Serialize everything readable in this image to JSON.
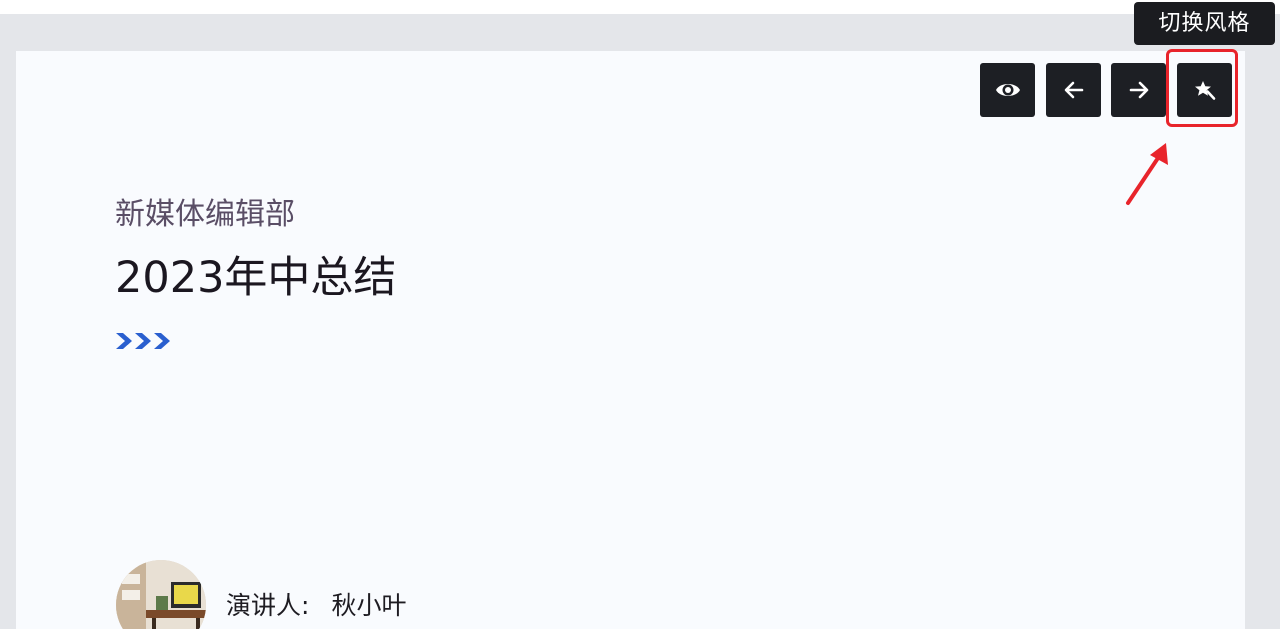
{
  "tooltip": {
    "text": "切换风格"
  },
  "toolbar": {
    "buttons": [
      {
        "name": "preview",
        "icon": "eye-icon"
      },
      {
        "name": "previous",
        "icon": "arrow-left-icon"
      },
      {
        "name": "next",
        "icon": "arrow-right-icon"
      },
      {
        "name": "switch-style",
        "icon": "magic-wand-icon"
      }
    ]
  },
  "slide": {
    "subtitle": "新媒体编辑部",
    "title": "2023年中总结",
    "decoration_icon": "triple-chevron-right-icon",
    "presenter_label": "演讲人:",
    "presenter_name": "秋小叶"
  },
  "colors": {
    "background": "#e4e6ea",
    "slide": "#f9fbfe",
    "toolbar_button": "#1d1f24",
    "highlight": "#e8242b",
    "chevron": "#2a5fcf",
    "subtitle": "#5a4e66",
    "title": "#1b1720"
  }
}
